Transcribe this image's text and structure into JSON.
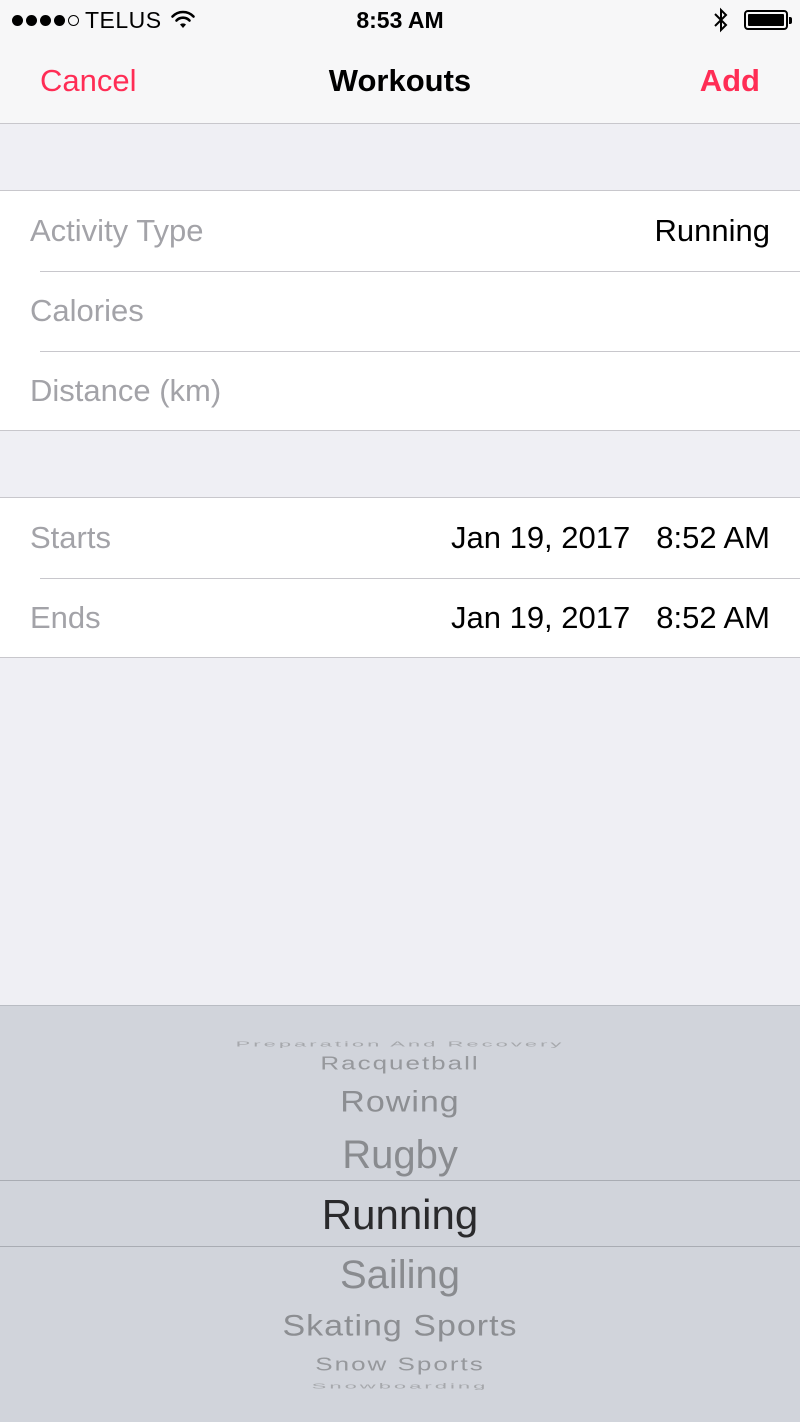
{
  "status_bar": {
    "carrier": "TELUS",
    "time": "8:53 AM",
    "signal_bars_filled": 4,
    "signal_bars_total": 5,
    "battery_level": 1.0,
    "icons": [
      "signal-dots-icon",
      "wifi-icon",
      "bluetooth-icon",
      "battery-icon"
    ]
  },
  "nav": {
    "cancel_label": "Cancel",
    "title": "Workouts",
    "add_label": "Add",
    "accent_color": "#ff2d55"
  },
  "form": {
    "activity": {
      "label": "Activity Type",
      "value": "Running"
    },
    "calories": {
      "label": "Calories",
      "value": ""
    },
    "distance": {
      "label": "Distance (km)",
      "value": ""
    },
    "starts": {
      "label": "Starts",
      "date": "Jan 19, 2017",
      "time": "8:52 AM"
    },
    "ends": {
      "label": "Ends",
      "date": "Jan 19, 2017",
      "time": "8:52 AM"
    }
  },
  "picker": {
    "items": [
      "Preparation And Recovery",
      "Racquetball",
      "Rowing",
      "Rugby",
      "Running",
      "Sailing",
      "Skating Sports",
      "Snow Sports",
      "Snowboarding"
    ],
    "selected": "Running"
  }
}
